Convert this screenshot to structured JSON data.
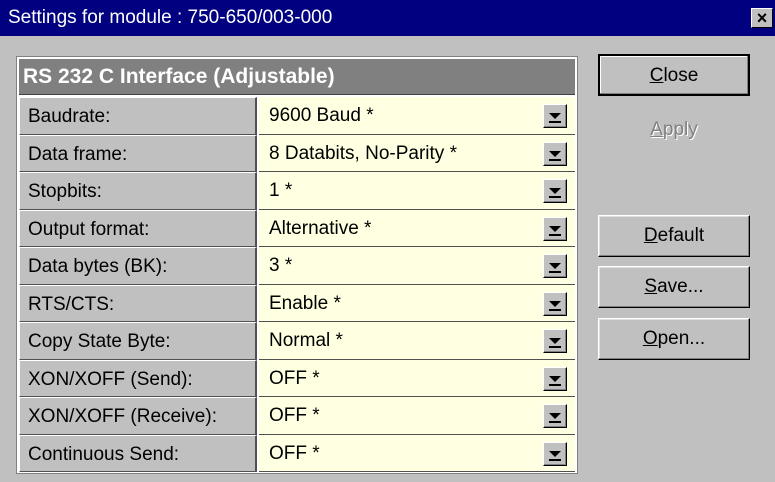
{
  "window": {
    "title": "Settings for module    : 750-650/003-000",
    "close_glyph": "×"
  },
  "panel": {
    "header": "RS 232 C Interface (Adjustable)",
    "rows": [
      {
        "label": "Baudrate:",
        "value": "9600 Baud *"
      },
      {
        "label": "Data frame:",
        "value": "8 Databits, No-Parity *"
      },
      {
        "label": "Stopbits:",
        "value": "1 *"
      },
      {
        "label": "Output format:",
        "value": "Alternative *"
      },
      {
        "label": "Data bytes (BK):",
        "value": "3 *"
      },
      {
        "label": "RTS/CTS:",
        "value": "Enable *"
      },
      {
        "label": "Copy State Byte:",
        "value": "Normal *"
      },
      {
        "label": "XON/XOFF (Send):",
        "value": "OFF *"
      },
      {
        "label": "XON/XOFF (Receive):",
        "value": "OFF *"
      },
      {
        "label": "Continuous Send:",
        "value": "OFF *"
      }
    ]
  },
  "buttons": {
    "close": {
      "accel": "C",
      "rest": "lose"
    },
    "apply": {
      "accel": "A",
      "rest": "pply"
    },
    "default": {
      "accel": "D",
      "rest": "efault"
    },
    "save": {
      "accel": "S",
      "rest": "ave..."
    },
    "open": {
      "accel": "O",
      "rest": "pen..."
    }
  },
  "icons": {
    "dropdown": "chevron-down-icon",
    "close": "close-icon"
  }
}
